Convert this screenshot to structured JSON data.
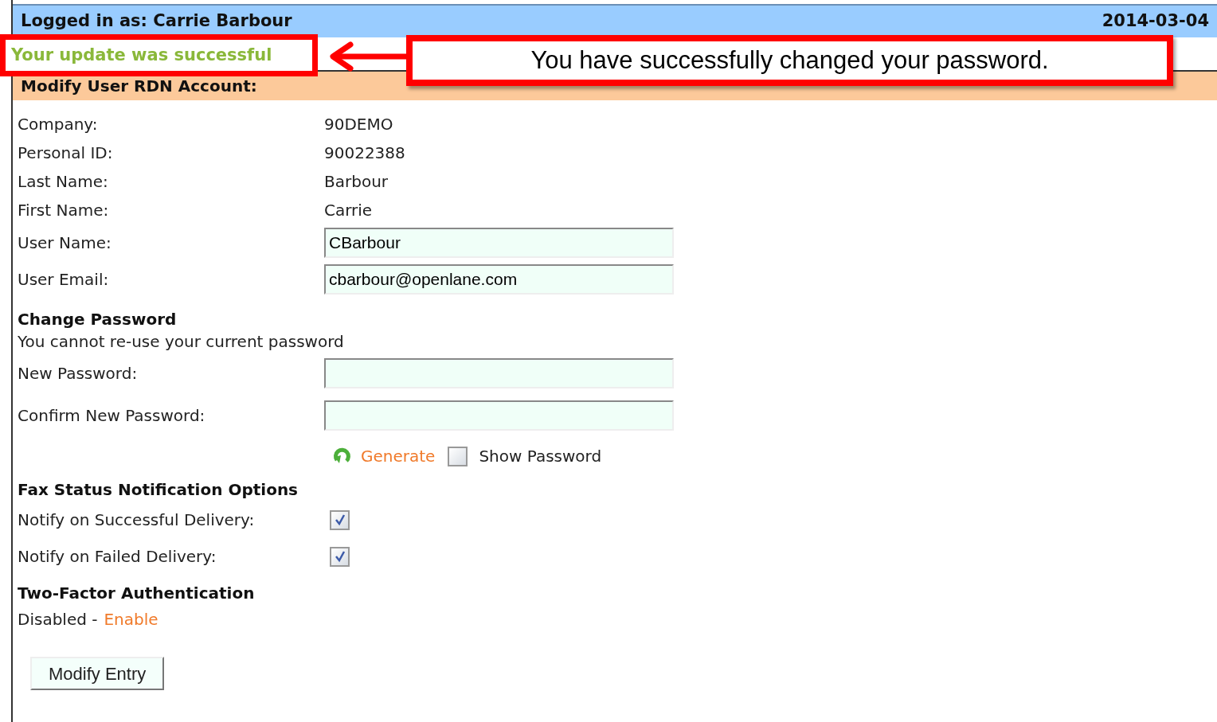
{
  "header": {
    "logged_in": "Logged in as: Carrie Barbour",
    "date": "2014-03-04"
  },
  "status_message": "Your update was successful",
  "callout": {
    "text": "You have successfully changed your password."
  },
  "section_title": "Modify User RDN Account:",
  "fields": [
    {
      "label": "Company:",
      "kind": "text",
      "value": "90DEMO"
    },
    {
      "label": "Personal ID:",
      "kind": "text",
      "value": "90022388"
    },
    {
      "label": "Last Name:",
      "kind": "text",
      "value": "Barbour"
    },
    {
      "label": "First Name:",
      "kind": "text",
      "value": "Carrie"
    },
    {
      "label": "User Name:",
      "kind": "input",
      "value": "CBarbour"
    },
    {
      "label": "User Email:",
      "kind": "input",
      "value": "cbarbour@openlane.com"
    }
  ],
  "change_password": {
    "title": "Change Password",
    "note": "You cannot re-use your current password",
    "fields": [
      {
        "label": "New Password:"
      },
      {
        "label": "Confirm New Password:"
      }
    ],
    "generate": "Generate",
    "show_password": {
      "label": "Show Password",
      "checked": false
    }
  },
  "fax": {
    "title": "Fax Status Notification Options",
    "options": [
      {
        "label": "Notify on Successful Delivery:",
        "checked": true
      },
      {
        "label": "Notify on Failed Delivery:",
        "checked": true
      }
    ]
  },
  "two_factor": {
    "title": "Two-Factor Authentication",
    "status": "Disabled -",
    "link": "Enable"
  },
  "button": "Modify Entry"
}
